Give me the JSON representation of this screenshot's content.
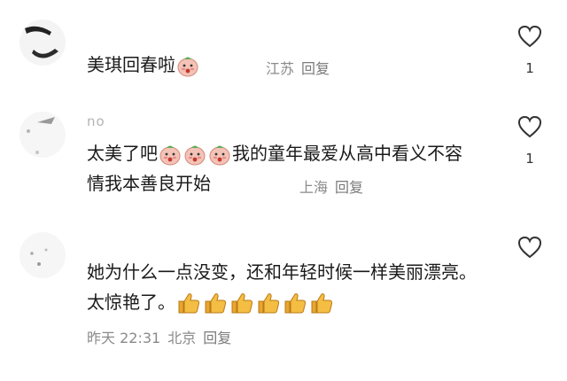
{
  "comments": [
    {
      "username": "",
      "text_before": "美琪回春啦",
      "emojis": [
        "blush-emoji"
      ],
      "text_after": "",
      "time": "",
      "location": "江苏",
      "reply_label": "回复",
      "likes": "1"
    },
    {
      "username": "no",
      "text_before": "太美了吧",
      "emojis": [
        "blush-emoji",
        "blush-emoji",
        "blush-emoji"
      ],
      "text_after": "我的童年最爱从高中看义不容情我本善良开始",
      "time": "",
      "location": "上海",
      "reply_label": "回复",
      "likes": "1"
    },
    {
      "username": "",
      "text_before": "她为什么一点没变，还和年轻时候一样美丽漂亮。太惊艳了。",
      "emojis": [
        "thumbs-up-emoji",
        "thumbs-up-emoji",
        "thumbs-up-emoji",
        "thumbs-up-emoji",
        "thumbs-up-emoji",
        "thumbs-up-emoji"
      ],
      "text_after": "",
      "time": "昨天 22:31",
      "location": "北京",
      "reply_label": "回复",
      "likes": ""
    }
  ],
  "colors": {
    "text": "#1a1a1a",
    "meta": "#8a8a8a",
    "blush_face": "#f4c2b6",
    "thumb": "#f2b43a"
  }
}
